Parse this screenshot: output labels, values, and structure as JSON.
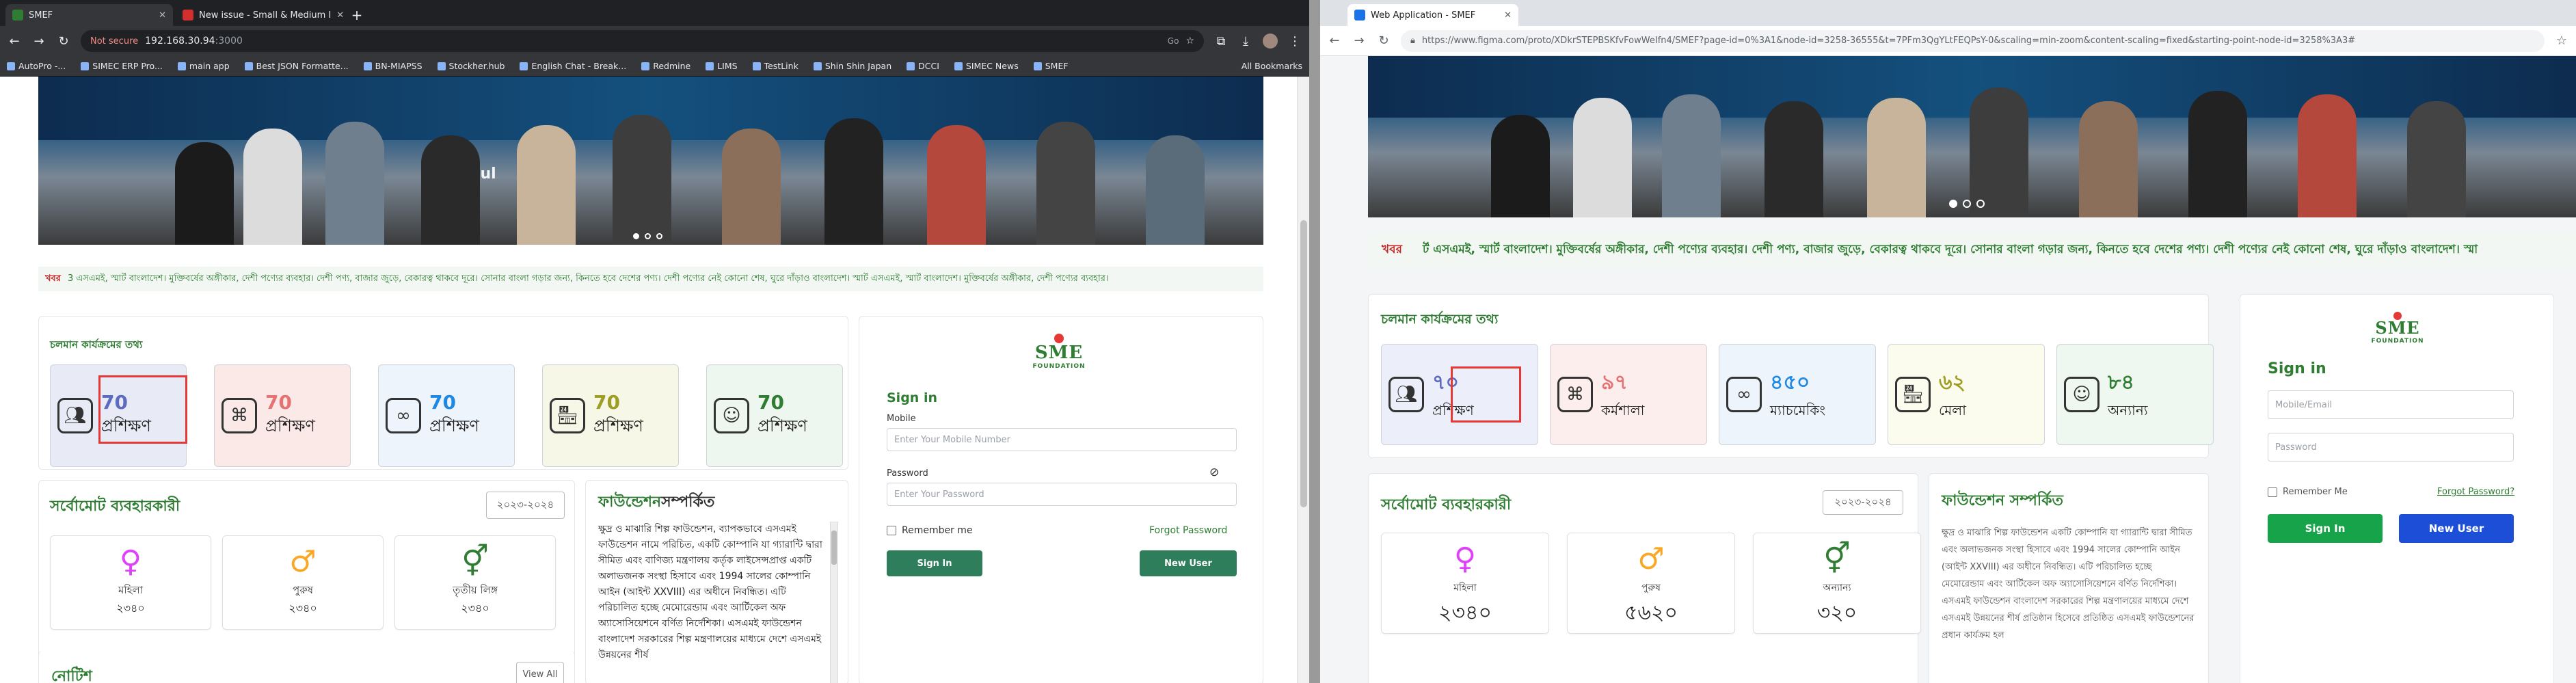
{
  "left": {
    "tabs": [
      {
        "title": "SMEF"
      },
      {
        "title": "New issue - Small & Medium I"
      }
    ],
    "new_tab": "+",
    "address": {
      "not_secure": "Not secure",
      "host": "192.168.30.94",
      "port": ":3000",
      "zoom": "Go"
    },
    "bookmarks": [
      "AutoPro -...",
      "SIMEC ERP Pro...",
      "main app",
      "Best JSON Formatte...",
      "BN-MIAPSS",
      "Stockher.hub",
      "English Chat - Break...",
      "Redmine",
      "LIMS",
      "TestLink",
      "Shin Shin Japan",
      "DCCI",
      "SIMEC News",
      "SMEF"
    ],
    "all_bookmarks": "All Bookmarks",
    "hero_text": "19 Jul",
    "ticker": {
      "head": "খবর",
      "text": "3 এসএমই, স্মার্ট বাংলাদেশ। মুক্তিবর্ষের অঙ্গীকার, দেশী পণ্যের ব্যবহার। দেশী পণ্য, বাজার জুড়ে, বেকারত্ব থাকবে দূরে। সোনার বাংলা গড়ার জন্য, কিনতে হবে দেশের পণ্য। দেশী পণ্যের নেই কোনো শেষ, ঘুরে দাঁড়াও বাংলাদেশ। স্মার্ট এসএমই, স্মার্ট বাংলাদেশ। মুক্তিবর্ষের অঙ্গীকার, দেশী পণ্যের ব্যবহার।"
    },
    "programs_title": "চলমান কার্যক্রমের তথ্য",
    "programs": [
      {
        "value": "70",
        "label": "প্রশিক্ষণ",
        "color": "#5c6bc0",
        "bg": "#e8eaf6"
      },
      {
        "value": "70",
        "label": "প্রশিক্ষণ",
        "color": "#e57373",
        "bg": "#fbe9e7"
      },
      {
        "value": "70",
        "label": "প্রশিক্ষণ",
        "color": "#1e88e5",
        "bg": "#eef4fb"
      },
      {
        "value": "70",
        "label": "প্রশিক্ষণ",
        "color": "#9e9d24",
        "bg": "#f7f7e8"
      },
      {
        "value": "70",
        "label": "প্রশিক্ষণ",
        "color": "#2e7d32",
        "bg": "#eef7ef"
      }
    ],
    "users": {
      "title": "সর্বোমোট ব্যবহারকারী",
      "year": "২০২৩-২০২৪",
      "cards": [
        {
          "symbol": "♀",
          "label": "মহিলা",
          "value": "২৩৪০",
          "color": "#e040fb"
        },
        {
          "symbol": "♂",
          "label": "পুরুষ",
          "value": "২৩৪০",
          "color": "#f9a825"
        },
        {
          "symbol": "⚥",
          "label": "তৃতীয় লিঙ্গ",
          "value": "২৩৪০",
          "color": "#2e7d32"
        }
      ]
    },
    "foundation": {
      "title_a": "ফাউন্ডেশন",
      "title_b": "সম্পর্কিত",
      "text": "ক্ষুদ্র ও মাঝারি শিল্প ফাউন্ডেশন, ব্যাপকভাবে এসএমই ফাউন্ডেশন নামে পরিচিত, একটি কোম্পানি যা গ্যারান্টি দ্বারা সীমিত এবং বাণিজ্য মন্ত্রণালয় কর্তৃক লাইসেন্সপ্রাপ্ত একটি অলাভজনক সংস্থা হিসাবে এবং 1994 সালের কোম্পানি আইন (আইন্ট XXVIII) এর অধীনে নিবন্ধিত। এটি পরিচালিত হচ্ছে মেমোরেন্ডাম এবং আর্টিকেল অফ অ্যাসোসিয়েশনে বর্ণিত নির্দেশিকা। এসএমই ফাউন্ডেশন বাংলাদেশ সরকারের শিল্প মন্ত্রণালয়ের মাধ্যমে দেশে এসএমই উন্নয়নের শীর্ষ"
    },
    "notice": {
      "title": "নোটিশ",
      "view_all": "View All"
    },
    "signin": {
      "title": "Sign in",
      "mobile_label": "Mobile",
      "mobile_placeholder": "Enter Your Mobile Number",
      "password_label": "Password",
      "password_placeholder": "Enter Your Password",
      "remember": "Remember me",
      "forgot": "Forgot Password",
      "signin_btn": "Sign In",
      "newuser_btn": "New User"
    },
    "logo": {
      "text": "SME",
      "sub": "FOUNDATION"
    }
  },
  "right": {
    "tabs": [
      {
        "title": "Web Application - SMEF"
      }
    ],
    "address": {
      "url": "https://www.figma.com/proto/XDkrSTEPBSKfvFowWeIfn4/SMEF?page-id=0%3A1&node-id=3258-36555&t=7PFm3QgYLtFEQPsY-0&scaling=min-zoom&content-scaling=fixed&starting-point-node-id=3258%3A3#"
    },
    "ticker": {
      "head": "খবর",
      "text": "র্ট এসএমই, স্মার্ট বাংলাদেশ। মুক্তিবর্ষের অঙ্গীকার, দেশী পণ্যের ব্যবহার। দেশী পণ্য, বাজার জুড়ে, বেকারত্ব থাকবে দূরে। সোনার বাংলা গড়ার জন্য, কিনতে হবে দেশের পণ্য। দেশী পণ্যের নেই কোনো শেষ, ঘুরে দাঁড়াও বাংলাদেশ। স্মা"
    },
    "programs_title": "চলমান কার্যক্রমের তথ্য",
    "programs": [
      {
        "value": "৭০",
        "label": "প্রশিক্ষণ",
        "color": "#5c6bc0",
        "bg": "#eceef9"
      },
      {
        "value": "৯৭",
        "label": "কর্মশালা",
        "color": "#e57373",
        "bg": "#fdeeee"
      },
      {
        "value": "৪৫০",
        "label": "ম্যাচমেকিং",
        "color": "#1e88e5",
        "bg": "#edf4fc"
      },
      {
        "value": "৬২",
        "label": "মেলা",
        "color": "#9e9d24",
        "bg": "#fbfbee"
      },
      {
        "value": "৮৪",
        "label": "অন্যান্য",
        "color": "#2e7d32",
        "bg": "#eef8f0"
      }
    ],
    "users": {
      "title": "সর্বোমোট ব্যবহারকারী",
      "year": "২০২৩-২০২৪",
      "cards": [
        {
          "symbol": "♀",
          "label": "মহিলা",
          "value": "২৩৪০",
          "color": "#e040fb"
        },
        {
          "symbol": "♂",
          "label": "পুরুষ",
          "value": "৫৬২০",
          "color": "#f9a825"
        },
        {
          "symbol": "⚥",
          "label": "অন্যান্য",
          "value": "৩২০",
          "color": "#2e7d32"
        }
      ]
    },
    "foundation": {
      "title": "ফাউন্ডেশন সম্পর্কিত",
      "text": "ক্ষুদ্র ও মাঝারি শিল্প ফাউন্ডেশন একটি কোম্পানি যা গ্যারান্টি দ্বারা সীমিত এবং অলাভজনক সংস্থা হিসাবে এবং 1994 সালের কোম্পানি আইন (আইন্ট XXVIII) এর অধীনে নিবন্ধিত। এটি পরিচালিত হচ্ছে মেমোরেন্ডাম এবং আর্টিকেল অফ অ্যাসোসিয়েশনে বর্ণিত নির্দেশিকা। এসএমই ফাউন্ডেশন বাংলাদেশ সরকারের শিল্প মন্ত্রণালয়ের মাধ্যমে দেশে এসএমই উন্নয়নের শীর্ষ প্রতিষ্ঠান হিসেবে প্রতিষ্ঠিত এসএমই ফাউন্ডেশনের প্রধান কার্যক্রম হল"
    },
    "signin": {
      "title": "Sign in",
      "mobile_placeholder": "Mobile/Email",
      "password_placeholder": "Password",
      "remember": "Remember Me",
      "forgot": "Forgot Password?",
      "signin_btn": "Sign In",
      "newuser_btn": "New User"
    },
    "logo": {
      "text": "SME",
      "sub": "FOUNDATION"
    }
  }
}
